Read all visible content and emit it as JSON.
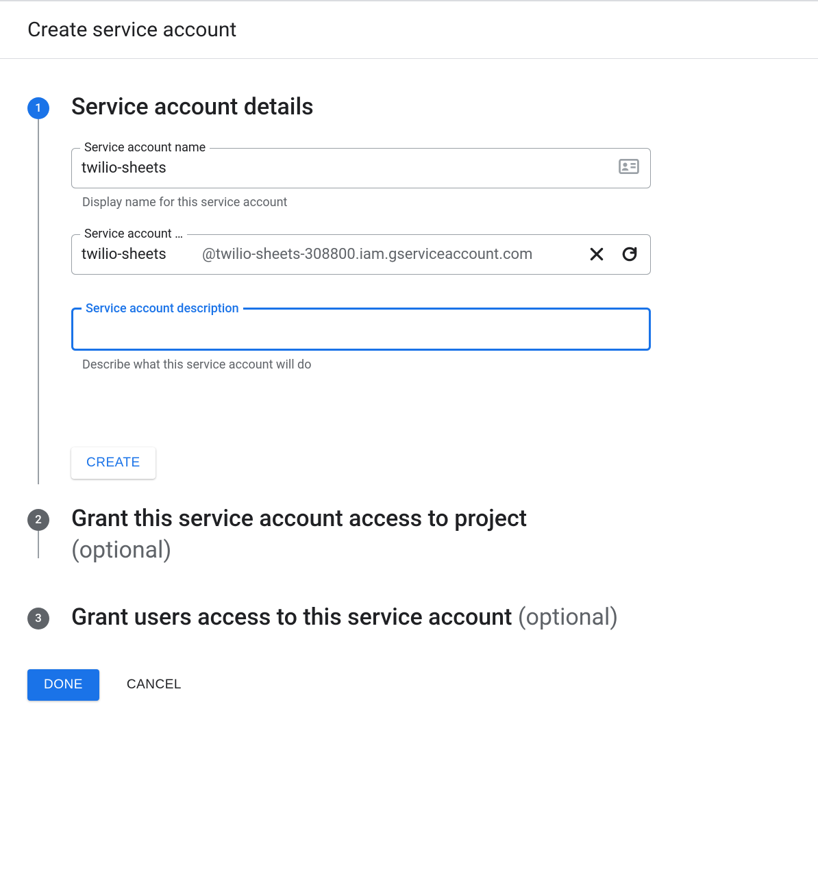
{
  "header": {
    "title": "Create service account"
  },
  "steps": {
    "s1": {
      "num": "1",
      "title": "Service account details",
      "name_label": "Service account name",
      "name_value": "twilio-sheets",
      "name_hint": "Display name for this service account",
      "id_label": "Service account …",
      "id_value": "twilio-sheets",
      "id_suffix": "@twilio-sheets-308800.iam.gserviceaccount.com",
      "desc_label": "Service account description",
      "desc_value": "",
      "desc_hint": "Describe what this service account will do",
      "create_label": "CREATE"
    },
    "s2": {
      "num": "2",
      "title": "Grant this service account access to project",
      "optional": "(optional)"
    },
    "s3": {
      "num": "3",
      "title": "Grant users access to this service account ",
      "optional": "(optional)"
    }
  },
  "footer": {
    "done": "DONE",
    "cancel": "CANCEL"
  }
}
